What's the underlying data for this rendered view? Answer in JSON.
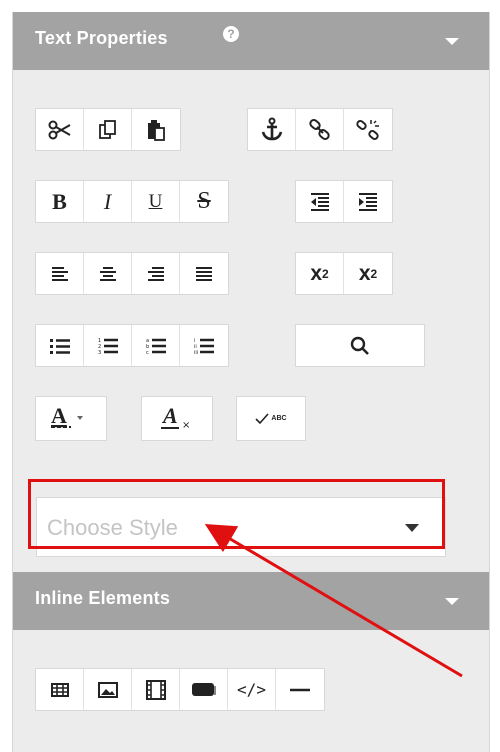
{
  "text_properties": {
    "title": "Text Properties",
    "help_icon": "question-circle-icon",
    "collapse_icon": "chevron-down-icon"
  },
  "toolbar": {
    "row1": [
      "cut-icon",
      "copy-icon",
      "paste-icon",
      "anchor-icon",
      "link-icon",
      "unlink-icon"
    ],
    "row2": [
      "bold-icon",
      "italic-icon",
      "underline-icon",
      "strikethrough-icon",
      "outdent-icon",
      "indent-icon"
    ],
    "row3": [
      "align-left-icon",
      "align-center-icon",
      "align-right-icon",
      "justify-icon",
      "superscript-icon",
      "subscript-icon"
    ],
    "row4": [
      "bullet-list-icon",
      "numbered-list-icon",
      "alpha-list-icon",
      "roman-list-icon",
      "search-icon"
    ],
    "row5": [
      "text-color-icon",
      "clear-formatting-icon",
      "spellcheck-icon"
    ],
    "bold_label": "B",
    "italic_label": "I",
    "underline_label": "U",
    "strike_label": "S",
    "superscript_label": "x",
    "superscript_exp": "2",
    "subscript_label": "x",
    "subscript_exp": "2",
    "spell_label": "ABC"
  },
  "style_select": {
    "placeholder": "Choose Style",
    "arrow_icon": "dropdown-arrow-icon"
  },
  "inline_elements": {
    "title": "Inline Elements",
    "collapse_icon": "chevron-down-icon",
    "buttons": [
      "table-icon",
      "image-icon",
      "video-icon",
      "button-element-icon",
      "code-icon",
      "horizontal-rule-icon"
    ],
    "code_label": "</>"
  },
  "annotation": {
    "highlight_color": "#e01010"
  }
}
